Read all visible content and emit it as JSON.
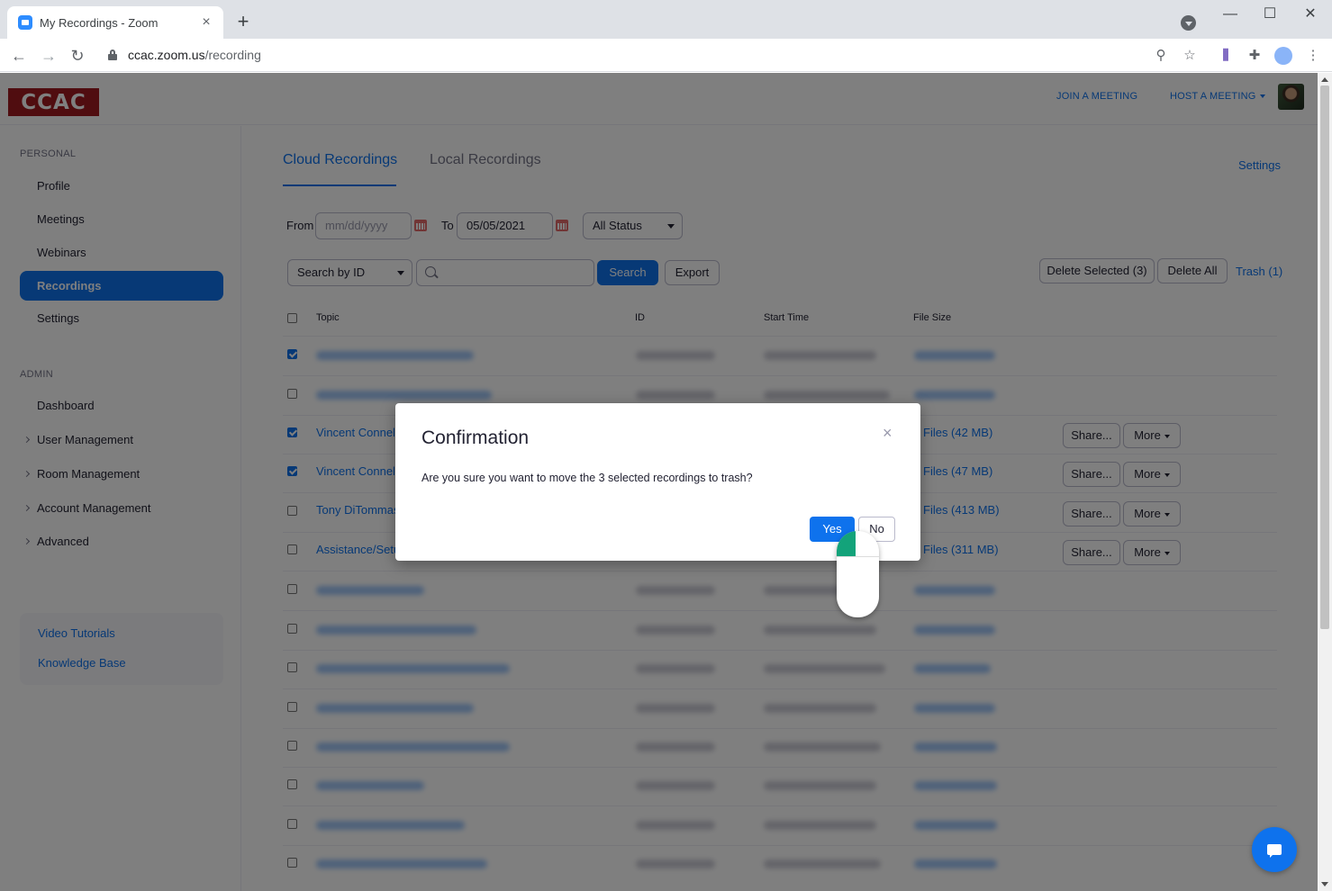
{
  "browser": {
    "tab_title": "My Recordings - Zoom",
    "tab_close": "×",
    "new_tab": "+",
    "url_domain": "ccac.zoom.us",
    "url_path": "/recording",
    "win_min": "—",
    "win_max": "☐",
    "win_close": "✕",
    "back": "←",
    "forward": "→",
    "reload": "↻",
    "zoom_icon": "⚲",
    "star_icon": "☆",
    "menu_icon": "⋮"
  },
  "header": {
    "logo": "CCAC",
    "join": "JOIN A MEETING",
    "host": "HOST A MEETING"
  },
  "sidebar": {
    "personal_header": "PERSONAL",
    "personal": [
      "Profile",
      "Meetings",
      "Webinars",
      "Recordings",
      "Settings"
    ],
    "admin_header": "ADMIN",
    "admin": [
      "Dashboard",
      "User Management",
      "Room Management",
      "Account Management",
      "Advanced"
    ],
    "help": [
      "Video Tutorials",
      "Knowledge Base"
    ]
  },
  "content": {
    "tabs": [
      "Cloud Recordings",
      "Local Recordings"
    ],
    "settings_link": "Settings",
    "from_label": "From",
    "from_placeholder": "mm/dd/yyyy",
    "to_label": "To",
    "to_value": "05/05/2021",
    "status_select": "All Status",
    "search_by_label": "Search by",
    "search_by_value": "ID",
    "search_button": "Search",
    "export_button": "Export",
    "delete_selected": "Delete Selected (3)",
    "delete_all": "Delete All",
    "trash": "Trash (1)"
  },
  "table": {
    "headers": [
      "Topic",
      "ID",
      "Start Time",
      "File Size"
    ],
    "visible_rows": [
      {
        "topic": "Vincent Connell",
        "files": "Files (42 MB)",
        "checked": true
      },
      {
        "topic": "Vincent Connell",
        "files": "Files (47 MB)",
        "checked": true
      },
      {
        "topic": "Tony DiTommas",
        "files": "Files (413 MB)",
        "checked": false
      },
      {
        "topic": "Assistance/Setu",
        "files": "Files (311 MB)",
        "checked": false
      }
    ],
    "share_label": "Share...",
    "more_label": "More"
  },
  "dialog": {
    "title": "Confirmation",
    "close": "×",
    "message": "Are you sure you want to move the 3 selected recordings to trash?",
    "yes": "Yes",
    "no": "No"
  },
  "colors": {
    "accent": "#0e72ed",
    "brand": "#a01a20"
  }
}
